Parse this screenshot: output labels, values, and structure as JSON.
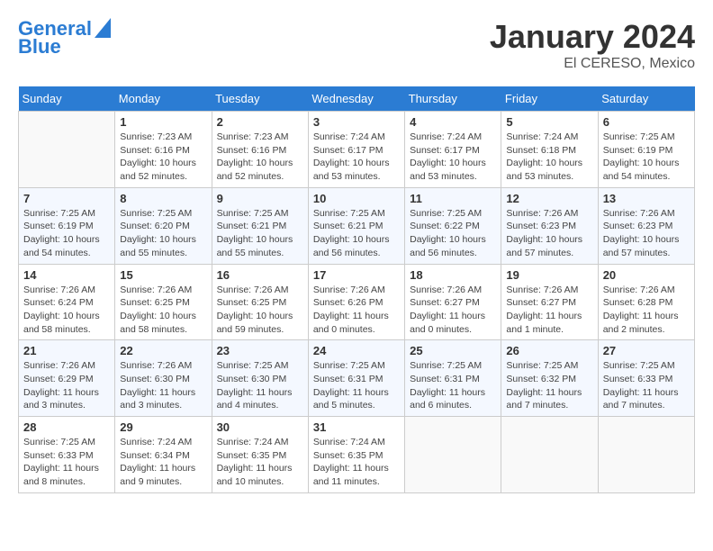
{
  "header": {
    "logo_line1": "General",
    "logo_line2": "Blue",
    "title": "January 2024",
    "subtitle": "El CERESO, Mexico"
  },
  "days_of_week": [
    "Sunday",
    "Monday",
    "Tuesday",
    "Wednesday",
    "Thursday",
    "Friday",
    "Saturday"
  ],
  "weeks": [
    [
      {
        "day": "",
        "info": ""
      },
      {
        "day": "1",
        "info": "Sunrise: 7:23 AM\nSunset: 6:16 PM\nDaylight: 10 hours\nand 52 minutes."
      },
      {
        "day": "2",
        "info": "Sunrise: 7:23 AM\nSunset: 6:16 PM\nDaylight: 10 hours\nand 52 minutes."
      },
      {
        "day": "3",
        "info": "Sunrise: 7:24 AM\nSunset: 6:17 PM\nDaylight: 10 hours\nand 53 minutes."
      },
      {
        "day": "4",
        "info": "Sunrise: 7:24 AM\nSunset: 6:17 PM\nDaylight: 10 hours\nand 53 minutes."
      },
      {
        "day": "5",
        "info": "Sunrise: 7:24 AM\nSunset: 6:18 PM\nDaylight: 10 hours\nand 53 minutes."
      },
      {
        "day": "6",
        "info": "Sunrise: 7:25 AM\nSunset: 6:19 PM\nDaylight: 10 hours\nand 54 minutes."
      }
    ],
    [
      {
        "day": "7",
        "info": "Sunrise: 7:25 AM\nSunset: 6:19 PM\nDaylight: 10 hours\nand 54 minutes."
      },
      {
        "day": "8",
        "info": "Sunrise: 7:25 AM\nSunset: 6:20 PM\nDaylight: 10 hours\nand 55 minutes."
      },
      {
        "day": "9",
        "info": "Sunrise: 7:25 AM\nSunset: 6:21 PM\nDaylight: 10 hours\nand 55 minutes."
      },
      {
        "day": "10",
        "info": "Sunrise: 7:25 AM\nSunset: 6:21 PM\nDaylight: 10 hours\nand 56 minutes."
      },
      {
        "day": "11",
        "info": "Sunrise: 7:25 AM\nSunset: 6:22 PM\nDaylight: 10 hours\nand 56 minutes."
      },
      {
        "day": "12",
        "info": "Sunrise: 7:26 AM\nSunset: 6:23 PM\nDaylight: 10 hours\nand 57 minutes."
      },
      {
        "day": "13",
        "info": "Sunrise: 7:26 AM\nSunset: 6:23 PM\nDaylight: 10 hours\nand 57 minutes."
      }
    ],
    [
      {
        "day": "14",
        "info": "Sunrise: 7:26 AM\nSunset: 6:24 PM\nDaylight: 10 hours\nand 58 minutes."
      },
      {
        "day": "15",
        "info": "Sunrise: 7:26 AM\nSunset: 6:25 PM\nDaylight: 10 hours\nand 58 minutes."
      },
      {
        "day": "16",
        "info": "Sunrise: 7:26 AM\nSunset: 6:25 PM\nDaylight: 10 hours\nand 59 minutes."
      },
      {
        "day": "17",
        "info": "Sunrise: 7:26 AM\nSunset: 6:26 PM\nDaylight: 11 hours\nand 0 minutes."
      },
      {
        "day": "18",
        "info": "Sunrise: 7:26 AM\nSunset: 6:27 PM\nDaylight: 11 hours\nand 0 minutes."
      },
      {
        "day": "19",
        "info": "Sunrise: 7:26 AM\nSunset: 6:27 PM\nDaylight: 11 hours\nand 1 minute."
      },
      {
        "day": "20",
        "info": "Sunrise: 7:26 AM\nSunset: 6:28 PM\nDaylight: 11 hours\nand 2 minutes."
      }
    ],
    [
      {
        "day": "21",
        "info": "Sunrise: 7:26 AM\nSunset: 6:29 PM\nDaylight: 11 hours\nand 3 minutes."
      },
      {
        "day": "22",
        "info": "Sunrise: 7:26 AM\nSunset: 6:30 PM\nDaylight: 11 hours\nand 3 minutes."
      },
      {
        "day": "23",
        "info": "Sunrise: 7:25 AM\nSunset: 6:30 PM\nDaylight: 11 hours\nand 4 minutes."
      },
      {
        "day": "24",
        "info": "Sunrise: 7:25 AM\nSunset: 6:31 PM\nDaylight: 11 hours\nand 5 minutes."
      },
      {
        "day": "25",
        "info": "Sunrise: 7:25 AM\nSunset: 6:31 PM\nDaylight: 11 hours\nand 6 minutes."
      },
      {
        "day": "26",
        "info": "Sunrise: 7:25 AM\nSunset: 6:32 PM\nDaylight: 11 hours\nand 7 minutes."
      },
      {
        "day": "27",
        "info": "Sunrise: 7:25 AM\nSunset: 6:33 PM\nDaylight: 11 hours\nand 7 minutes."
      }
    ],
    [
      {
        "day": "28",
        "info": "Sunrise: 7:25 AM\nSunset: 6:33 PM\nDaylight: 11 hours\nand 8 minutes."
      },
      {
        "day": "29",
        "info": "Sunrise: 7:24 AM\nSunset: 6:34 PM\nDaylight: 11 hours\nand 9 minutes."
      },
      {
        "day": "30",
        "info": "Sunrise: 7:24 AM\nSunset: 6:35 PM\nDaylight: 11 hours\nand 10 minutes."
      },
      {
        "day": "31",
        "info": "Sunrise: 7:24 AM\nSunset: 6:35 PM\nDaylight: 11 hours\nand 11 minutes."
      },
      {
        "day": "",
        "info": ""
      },
      {
        "day": "",
        "info": ""
      },
      {
        "day": "",
        "info": ""
      }
    ]
  ]
}
